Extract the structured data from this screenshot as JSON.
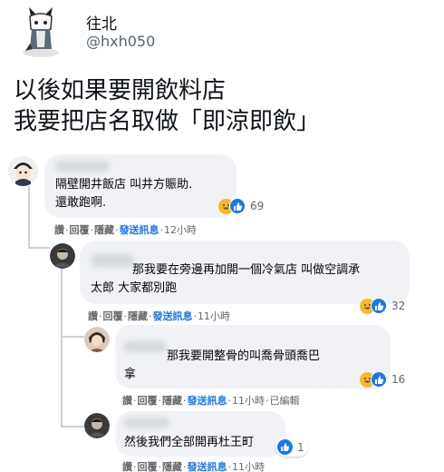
{
  "header": {
    "name": "往北",
    "handle": "@hxh050"
  },
  "post": {
    "lines": [
      "以後如果要開飲料店",
      "我要把店名取做「即涼即飲」"
    ]
  },
  "comments": [
    {
      "lines": [
        "隔壁開井飯店 叫井方賑助.",
        "還敢跑啊."
      ],
      "reactions": "69",
      "actions": {
        "like": "讚",
        "reply": "回覆",
        "hide": "隱藏",
        "message": "發送訊息",
        "time": "12小時"
      }
    },
    {
      "lines": [
        "那我要在旁邊再加開一個冷氣店 叫做空調承",
        "太郎 大家都別跑"
      ],
      "reactions": "32",
      "actions": {
        "like": "讚",
        "reply": "回覆",
        "hide": "隱藏",
        "message": "發送訊息",
        "time": "11小時"
      }
    },
    {
      "lines": [
        "那我要開整骨的叫喬骨頭喬巴",
        "拿"
      ],
      "reactions": "16",
      "actions": {
        "like": "讚",
        "reply": "回覆",
        "hide": "隱藏",
        "message": "發送訊息",
        "time": "11小時",
        "edited": "已編輯"
      }
    },
    {
      "lines": [
        "然後我們全部開再杜王町"
      ],
      "reactions": "1",
      "actions": {
        "like": "讚",
        "reply": "回覆",
        "hide": "隱藏",
        "message": "發送訊息",
        "time": "11小時"
      }
    }
  ],
  "colors": {
    "bubble": "#f0f2f5",
    "link": "#1877f2",
    "laugh": "#f7b928",
    "like": "#1877f2"
  },
  "icons": [
    "avatar-cat-icon",
    "laugh-reaction-icon",
    "like-reaction-icon"
  ]
}
